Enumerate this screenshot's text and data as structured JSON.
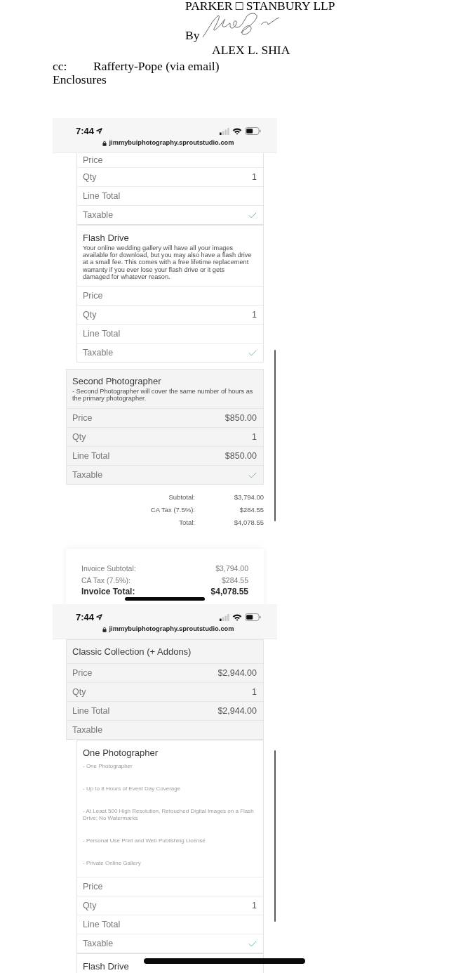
{
  "letter": {
    "firm": "PARKER □ STANBURY LLP",
    "by_label": "By",
    "signer": "ALEX L. SHIA",
    "cc_label": "cc:",
    "cc_recipient": "Rafferty-Pope (via email)",
    "enclosures": "Enclosures"
  },
  "screens": [
    {
      "status_bar": {
        "time": "7:44",
        "url": "jimmybuiphotography.sproutstudio.com"
      },
      "items": [
        {
          "kind": "addon",
          "rows": [
            {
              "kind": "amount",
              "label": "Price"
            },
            {
              "kind": "amount",
              "label": "Qty",
              "value": "1"
            },
            {
              "kind": "amount",
              "label": "Line Total"
            },
            {
              "kind": "check",
              "label": "Taxable",
              "checked": true
            }
          ]
        },
        {
          "kind": "addon",
          "title": "Flash Drive",
          "description": "Your online wedding gallery will have all your images available for download, but you may also have a flash drive at a small fee. This comes with a free lifetime replacement warranty if you ever lose your flash drive or it gets damaged for whatever reason.",
          "rows": [
            {
              "kind": "amount",
              "label": "Price"
            },
            {
              "kind": "amount",
              "label": "Qty",
              "value": "1"
            },
            {
              "kind": "amount",
              "label": "Line Total"
            },
            {
              "kind": "check",
              "label": "Taxable",
              "checked": true
            }
          ]
        },
        {
          "kind": "package",
          "title": "Second Photographer",
          "description": "- Second Photographer will cover the same number of hours as the primary photographer.",
          "rows": [
            {
              "kind": "amount",
              "label": "Price",
              "value": "$850.00"
            },
            {
              "kind": "amount",
              "label": "Qty",
              "value": "1"
            },
            {
              "kind": "amount",
              "label": "Line Total",
              "value": "$850.00"
            },
            {
              "kind": "check",
              "label": "Taxable",
              "checked": true
            }
          ]
        }
      ],
      "totals": [
        {
          "label": "Subtotal:",
          "value": "$3,794.00"
        },
        {
          "label": "CA Tax (7.5%):",
          "value": "$284.55"
        },
        {
          "label": "Total:",
          "value": "$4,078.55"
        }
      ],
      "invoice_summary": [
        {
          "label": "Invoice Subtotal:",
          "value": "$3,794.00",
          "emphasis": false
        },
        {
          "label": "CA Tax (7.5%):",
          "value": "$284.55",
          "emphasis": false
        },
        {
          "label": "Invoice Total:",
          "value": "$4,078.55",
          "emphasis": true
        }
      ]
    },
    {
      "status_bar": {
        "time": "7:44",
        "url": "jimmybuiphotography.sproutstudio.com"
      },
      "items": [
        {
          "kind": "package",
          "title": "Classic Collection (+ Addons)",
          "rows": [
            {
              "kind": "amount",
              "label": "Price",
              "value": "$2,944.00"
            },
            {
              "kind": "amount",
              "label": "Qty",
              "value": "1"
            },
            {
              "kind": "amount",
              "label": "Line Total",
              "value": "$2,944.00"
            },
            {
              "kind": "check",
              "label": "Taxable",
              "checked": false
            }
          ]
        },
        {
          "kind": "addon",
          "title": "One Photographer",
          "bullets": [
            "- One Photographer",
            "- Up to 8 Hours of Event Day Coverage",
            "- At Least 500 High Resolution, Retouched Digital Images on a Flash Drive; No Watermarks",
            "- Personal Use Print and Web Publishing License",
            "- Private Online Gallery"
          ],
          "rows": [
            {
              "kind": "amount",
              "label": "Price"
            },
            {
              "kind": "amount",
              "label": "Qty",
              "value": "1"
            },
            {
              "kind": "amount",
              "label": "Line Total"
            },
            {
              "kind": "check",
              "label": "Taxable",
              "checked": true
            }
          ]
        },
        {
          "kind": "addon",
          "title": "Flash Drive"
        }
      ]
    }
  ]
}
